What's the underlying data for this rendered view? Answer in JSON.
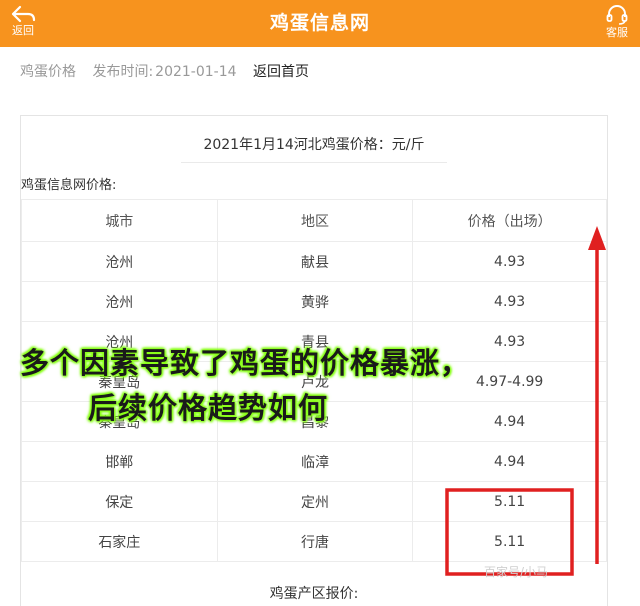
{
  "header": {
    "back_label": "返回",
    "title": "鸡蛋信息网",
    "service_label": "客服",
    "back_icon": "back-arrow-icon",
    "service_icon": "headset-icon",
    "background_color": "#f7931e"
  },
  "meta": {
    "category": "鸡蛋价格",
    "publish_label": "发布时间:",
    "publish_date": "2021-01-14",
    "home_link": "返回首页"
  },
  "article": {
    "caption": "2021年1月14河北鸡蛋价格：元/斤",
    "section_title": "鸡蛋信息网价格:",
    "table": {
      "headers": [
        "城市",
        "地区",
        "价格（出场）"
      ],
      "rows": [
        [
          "沧州",
          "献县",
          "4.93"
        ],
        [
          "沧州",
          "黄骅",
          "4.93"
        ],
        [
          "沧州",
          "青县",
          "4.93"
        ],
        [
          "秦皇岛",
          "卢龙",
          "4.97-4.99"
        ],
        [
          "秦皇岛",
          "昌黎",
          "4.94"
        ],
        [
          "邯郸",
          "临漳",
          "4.94"
        ],
        [
          "保定",
          "定州",
          "5.11"
        ],
        [
          "石家庄",
          "行唐",
          "5.11"
        ]
      ]
    },
    "footer_title": "鸡蛋产区报价:"
  },
  "overlay": {
    "line1": "多个因素导致了鸡蛋的价格暴涨，",
    "line2": "后续价格趋势如何",
    "glow_color": "#7cff00",
    "annotation_color": "#e02020"
  },
  "watermark": "百家号/小马"
}
